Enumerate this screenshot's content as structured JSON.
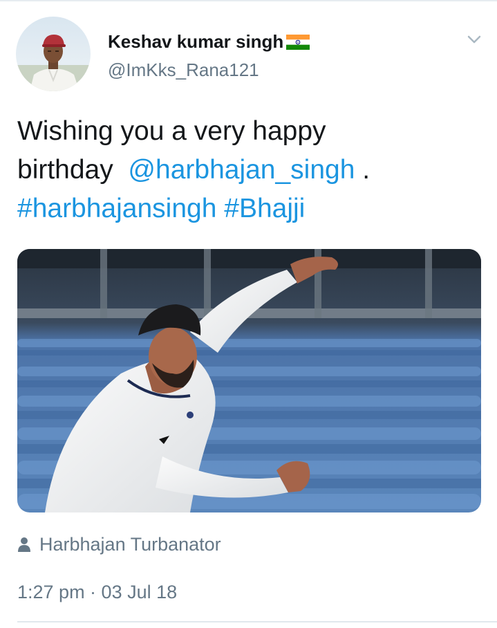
{
  "tweet": {
    "author": {
      "display_name": "Keshav kumar singh",
      "handle": "@ImKks_Rana121",
      "flag_icon": "india-flag-icon"
    },
    "text": {
      "line1": "Wishing you a very happy",
      "line2_prefix": "birthday",
      "mention": "@harbhajan_singh",
      "line2_suffix": ".",
      "hashtag1": "#harbhajansingh",
      "hashtag2": "#Bhajji"
    },
    "tagged_user": "Harbhajan Turbanator",
    "timestamp": "1:27 pm · 03 Jul 18"
  },
  "icons": {
    "menu": "chevron-down-icon",
    "tag": "person-icon"
  },
  "colors": {
    "link": "#1b95e0",
    "secondary_text": "#657786",
    "primary_text": "#14171a",
    "divider": "#e1e8ed"
  }
}
